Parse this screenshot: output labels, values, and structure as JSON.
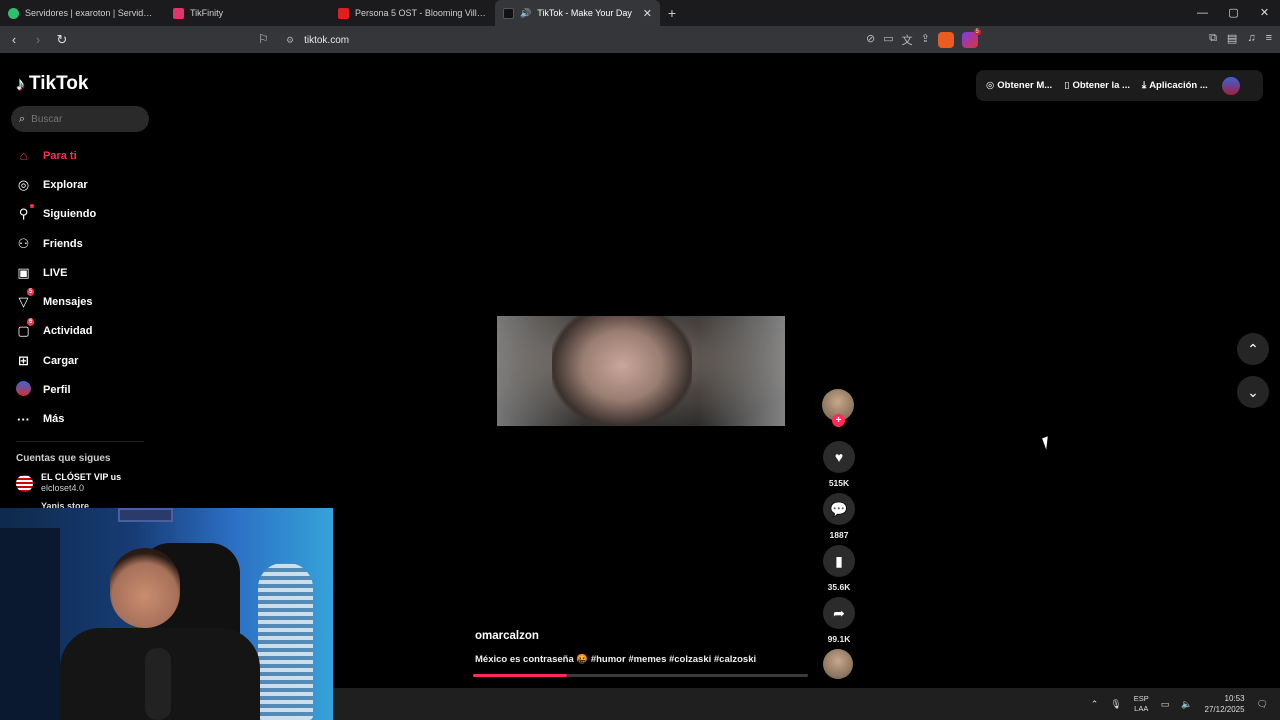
{
  "browser": {
    "tabs": [
      {
        "label": "Servidores | exaroton | Servidores de",
        "fav_color": "#2fbf71"
      },
      {
        "label": "TikFinity",
        "fav_color": "#e0356a"
      },
      {
        "label": "Persona 5 OST - Blooming Villain [Ext",
        "fav_color": "#e02020"
      },
      {
        "label": "TikTok - Make Your Day",
        "fav_color": "#111111"
      }
    ],
    "new_tab": "+",
    "url": "tiktok.com",
    "window_controls": {
      "minimize": "—",
      "maximize": "▢",
      "close": "✕"
    },
    "rewards_badge": "5"
  },
  "tiktok": {
    "logo": "TikTok",
    "search": {
      "placeholder": "Buscar"
    },
    "nav": [
      {
        "label": "Para ti",
        "icon": "home-icon",
        "active": true
      },
      {
        "label": "Explorar",
        "icon": "compass-icon"
      },
      {
        "label": "Siguiendo",
        "icon": "following-icon"
      },
      {
        "label": "Friends",
        "icon": "friends-icon"
      },
      {
        "label": "LIVE",
        "icon": "live-icon"
      },
      {
        "label": "Mensajes",
        "icon": "messages-icon",
        "badge": "5"
      },
      {
        "label": "Actividad",
        "icon": "activity-icon",
        "badge": "6"
      },
      {
        "label": "Cargar",
        "icon": "upload-icon"
      },
      {
        "label": "Perfil",
        "icon": "profile-icon"
      },
      {
        "label": "Más",
        "icon": "more-icon"
      }
    ],
    "following_header": "Cuentas que sigues",
    "following": [
      {
        "name": "EL CLÓSET VIP us",
        "username": "elcloset4.0"
      },
      {
        "name": "Yanis store",
        "username": ""
      }
    ],
    "top_actions": [
      "Obtener M...",
      "Obtener la ...",
      "Aplicación ..."
    ],
    "video": {
      "author": "omarcalzon",
      "caption": "México es contraseña 🤬 #humor #memes #colzaski #calzoski",
      "progress": 0.28,
      "likes": "515K",
      "comments": "1887",
      "saves": "35.6K",
      "shares": "99.1K"
    }
  },
  "taskbar": {
    "lang_top": "ESP",
    "lang_bottom": "LAA",
    "time": "10:53",
    "date": "27/12/2025"
  },
  "colors": {
    "accent": "#fe2c55",
    "chrome_bg": "#35363a"
  }
}
